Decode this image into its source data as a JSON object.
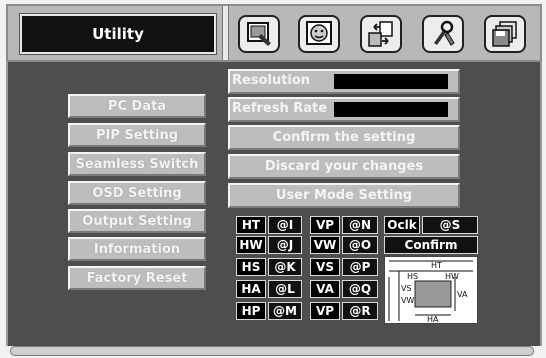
{
  "header": {
    "title": "Utility",
    "icons": [
      "display-settings-icon",
      "face-icon",
      "swap-icon",
      "tools-icon",
      "disk-icon"
    ]
  },
  "menu": {
    "items": [
      {
        "label": "PC Data"
      },
      {
        "label": "PIP Setting"
      },
      {
        "label": "Seamless Switch"
      },
      {
        "label": "OSD Setting"
      },
      {
        "label": "Output Setting"
      },
      {
        "label": "Information"
      },
      {
        "label": "Factory Reset"
      }
    ]
  },
  "panel": {
    "resolution_label": "Resolution",
    "refresh_rate_label": "Refresh Rate",
    "confirm_setting": "Confirm the setting",
    "discard_changes": "Discard your changes",
    "user_mode": "User Mode Setting"
  },
  "timing": {
    "rows": [
      {
        "k1": "HT",
        "v1": "@I",
        "k2": "VP",
        "v2": "@N"
      },
      {
        "k1": "HW",
        "v1": "@J",
        "k2": "VW",
        "v2": "@O"
      },
      {
        "k1": "HS",
        "v1": "@K",
        "k2": "VS",
        "v2": "@P"
      },
      {
        "k1": "HA",
        "v1": "@L",
        "k2": "VA",
        "v2": "@Q"
      },
      {
        "k1": "HP",
        "v1": "@M",
        "k2": "VP",
        "v2": "@R"
      }
    ],
    "oclk_label": "Oclk",
    "oclk_value": "@S",
    "confirm": "Confirm"
  },
  "diagram": {
    "labels": [
      "HT",
      "HS",
      "HW",
      "VS",
      "VW",
      "VA",
      "HA"
    ]
  }
}
